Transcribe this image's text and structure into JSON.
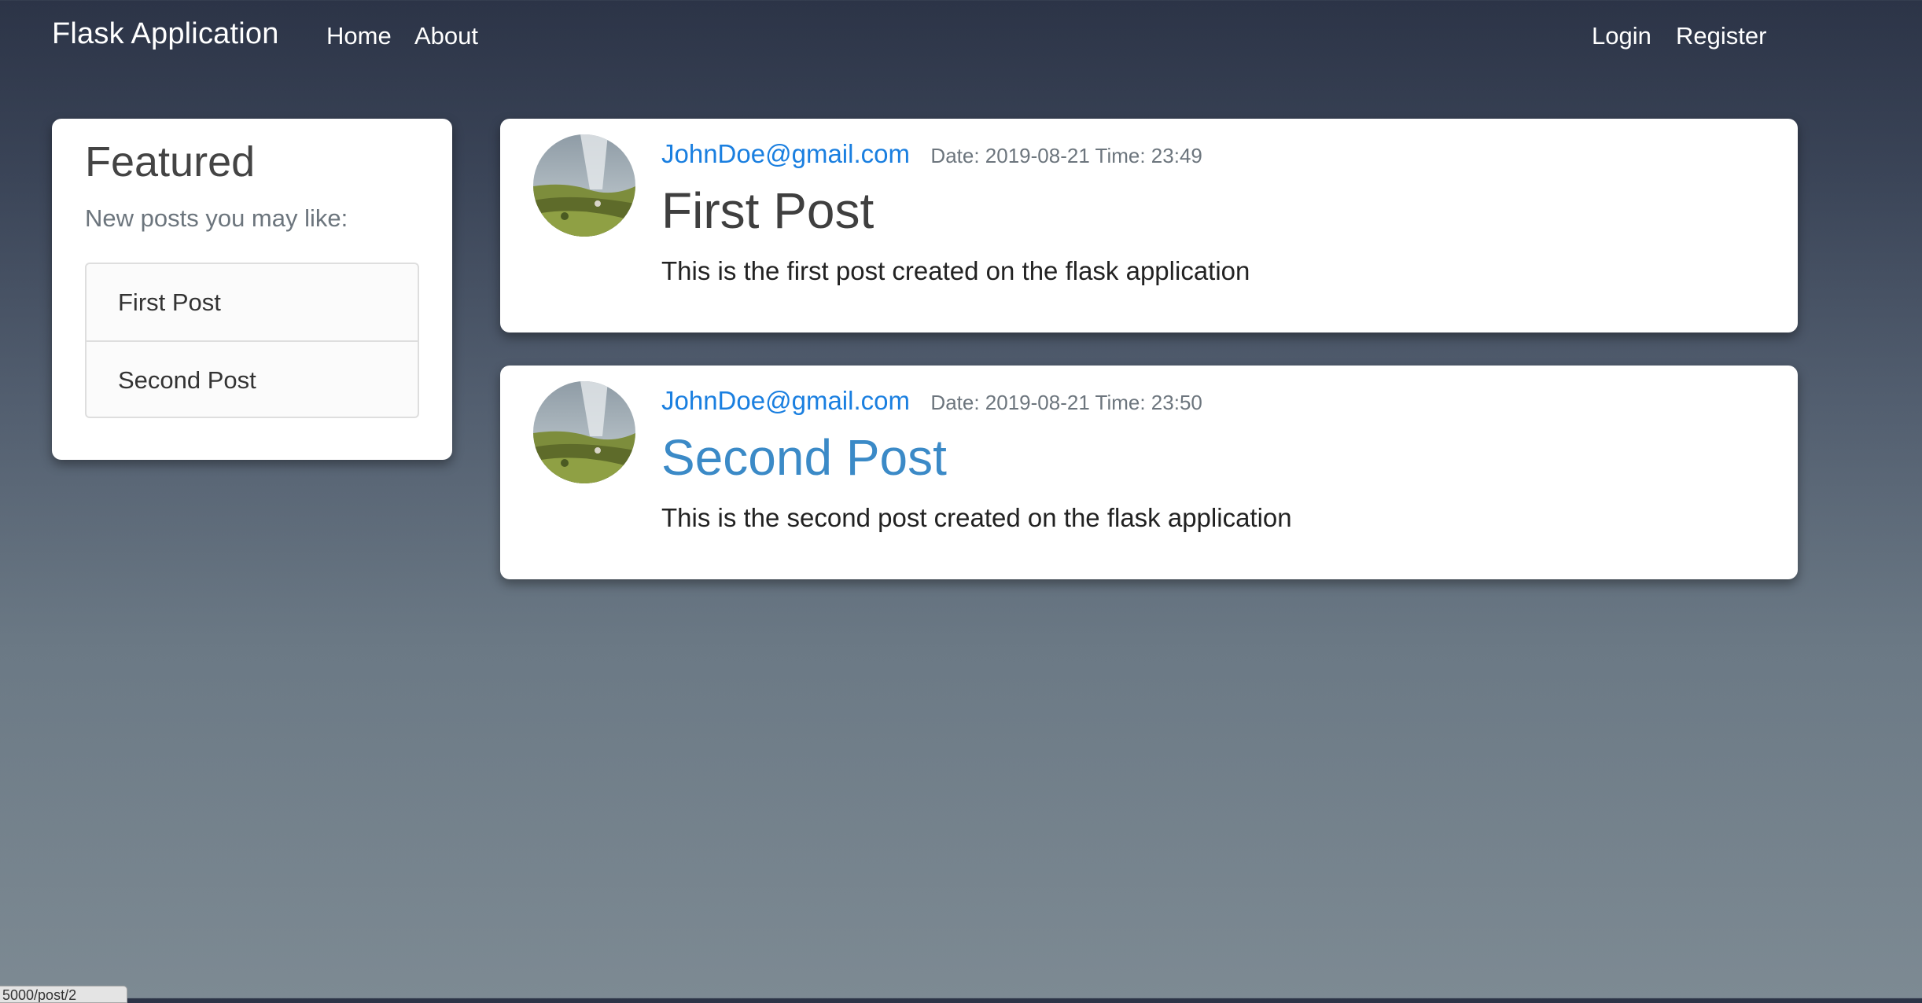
{
  "navbar": {
    "brand": "Flask Application",
    "links": {
      "home": "Home",
      "about": "About",
      "login": "Login",
      "register": "Register"
    }
  },
  "sidebar": {
    "title": "Featured",
    "subtitle": "New posts you may like:",
    "items": [
      {
        "label": "First Post"
      },
      {
        "label": "Second Post"
      }
    ]
  },
  "posts": [
    {
      "author": "JohnDoe@gmail.com",
      "date": "Date: 2019-08-21 Time: 23:49",
      "title": "First Post",
      "content": "This is the first post created on the flask application",
      "avatar_icon": "landscape-avatar-icon"
    },
    {
      "author": "JohnDoe@gmail.com",
      "date": "Date: 2019-08-21 Time: 23:50",
      "title": "Second Post",
      "content": "This is the second post created on the flask application",
      "avatar_icon": "landscape-avatar-icon",
      "title_hovered": true
    }
  ],
  "status_bar": {
    "url": "5000/post/2"
  },
  "colors": {
    "author_link": "#1a7fe0",
    "hovered_title": "#3b8ac7",
    "muted_text": "#6c757d"
  }
}
